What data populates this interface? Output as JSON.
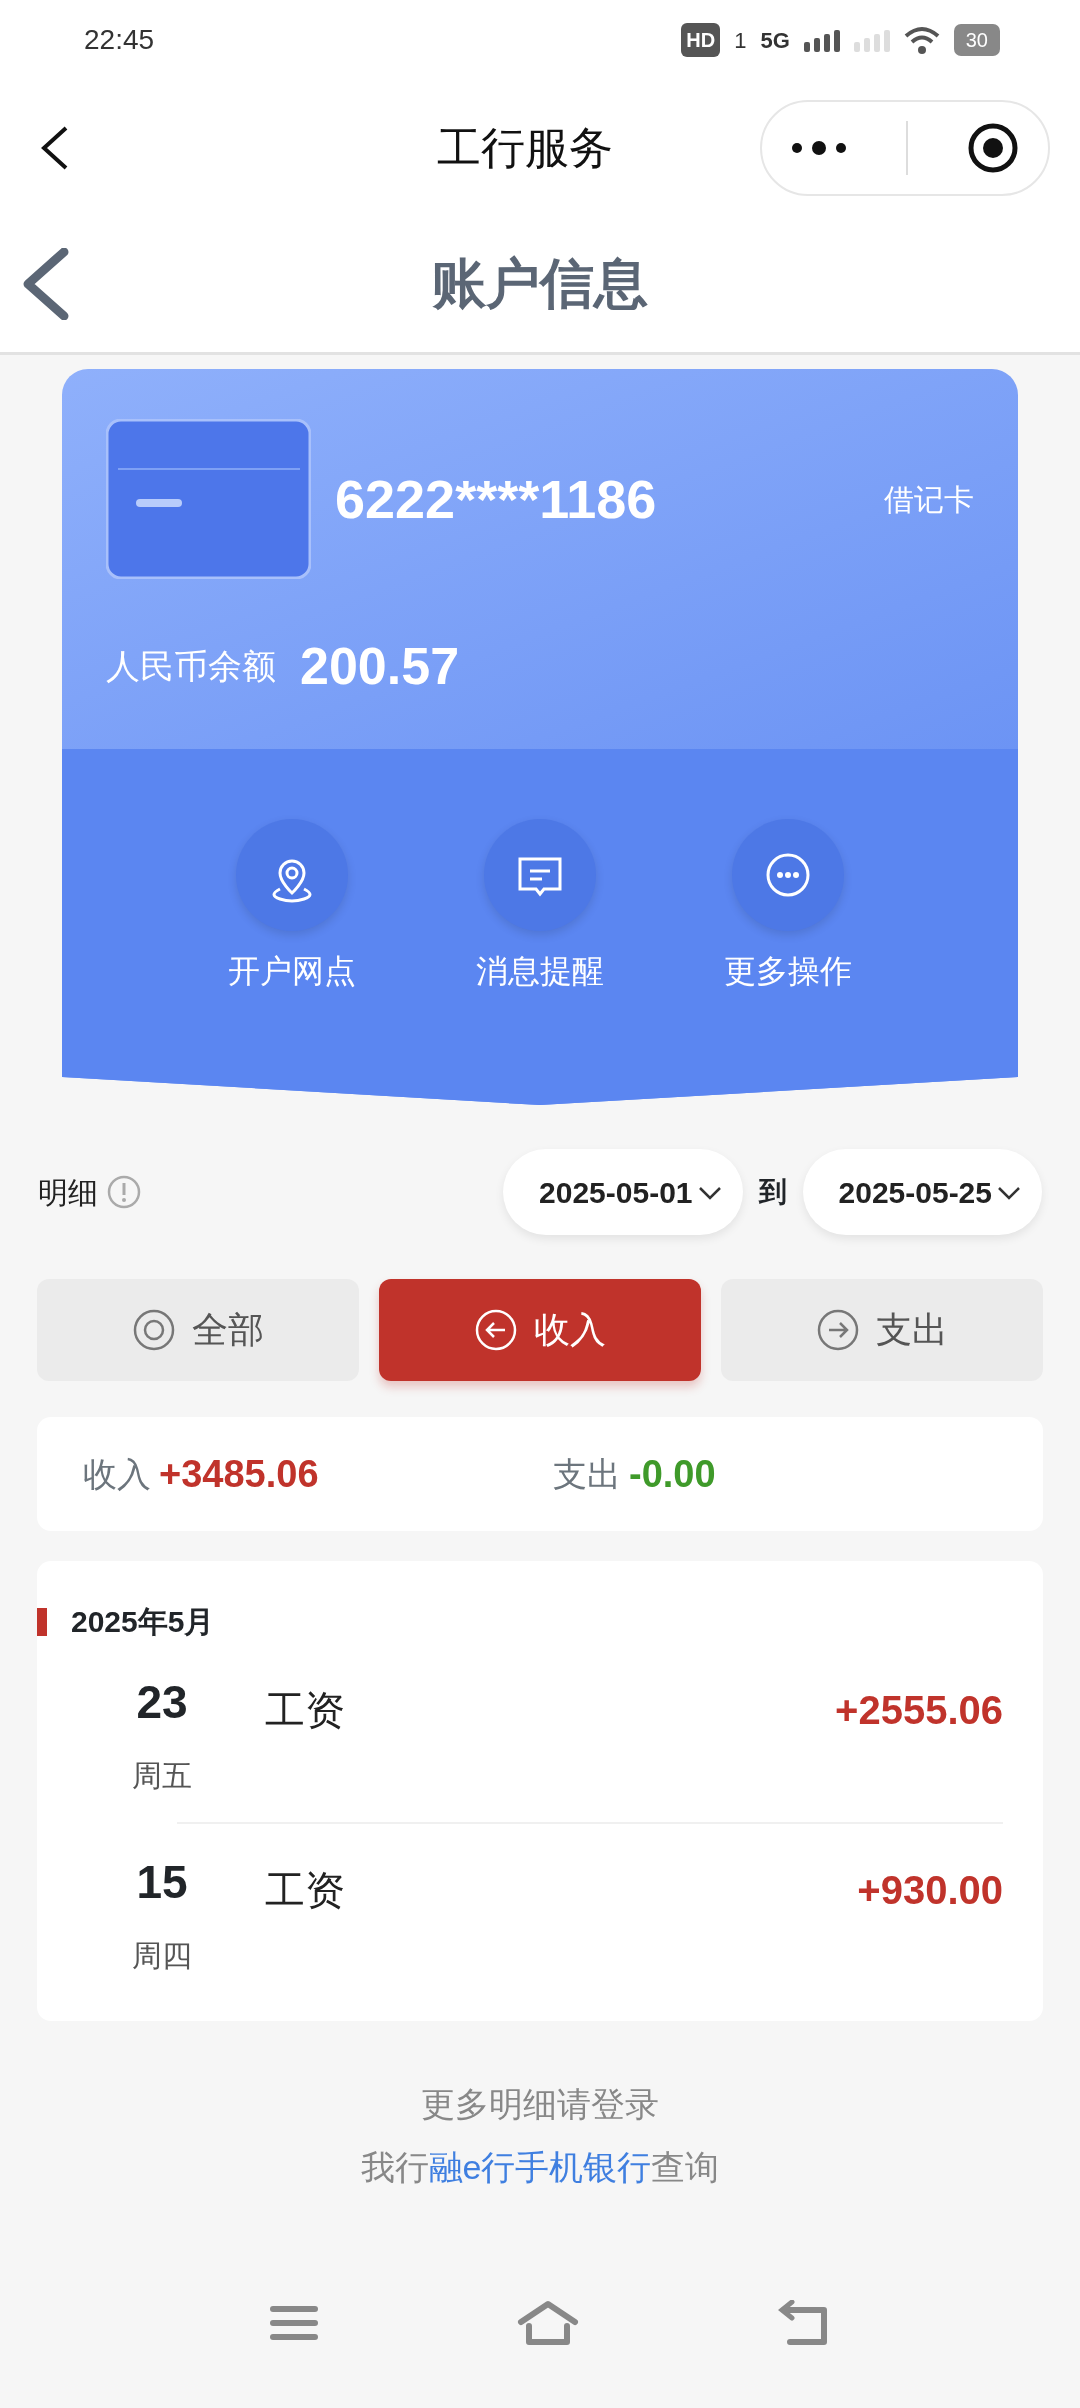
{
  "status_bar": {
    "time": "22:45",
    "hd": "HD",
    "sim": "1",
    "network": "5G",
    "battery": "30"
  },
  "mini_nav": {
    "title": "工行服务"
  },
  "header": {
    "title": "账户信息"
  },
  "account": {
    "number": "6222****1186",
    "card_type": "借记卡",
    "balance_label": "人民币余额",
    "balance": "200.57",
    "actions": [
      {
        "kind": "branch",
        "label": "开户网点"
      },
      {
        "kind": "message",
        "label": "消息提醒"
      },
      {
        "kind": "more",
        "label": "更多操作"
      }
    ]
  },
  "filter": {
    "label": "明细",
    "date_from": "2025-05-01",
    "to_label": "到",
    "date_to": "2025-05-25"
  },
  "tabs": [
    {
      "kind": "all",
      "label": "全部",
      "selected": false
    },
    {
      "kind": "in",
      "label": "收入",
      "selected": true
    },
    {
      "kind": "out",
      "label": "支出",
      "selected": false
    }
  ],
  "summary": {
    "income_label": "收入",
    "income": "+3485.06",
    "expense_label": "支出",
    "expense": "-0.00"
  },
  "transactions": {
    "month": "2025年5月",
    "rows": [
      {
        "day": "23",
        "weekday": "周五",
        "title": "工资",
        "amount": "+2555.06"
      },
      {
        "day": "15",
        "weekday": "周四",
        "title": "工资",
        "amount": "+930.00"
      }
    ]
  },
  "footer": {
    "line1": "更多明细请登录",
    "line2_before": "我行",
    "line2_link": "融e行手机银行",
    "line2_after": "查询"
  }
}
